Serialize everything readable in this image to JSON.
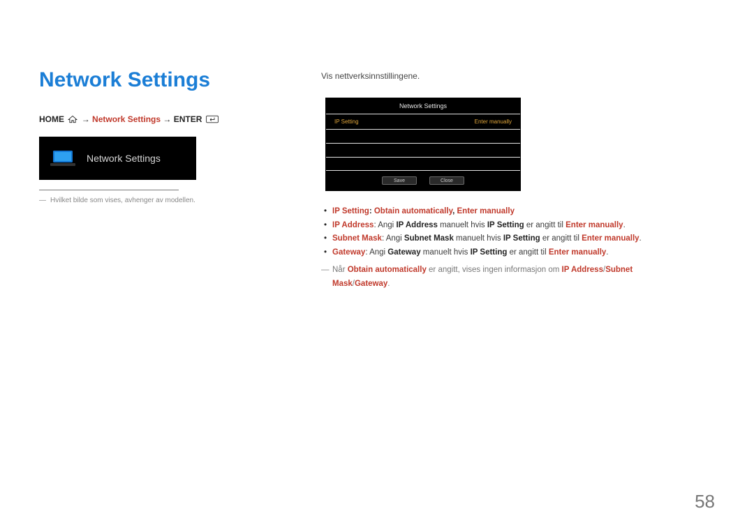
{
  "title": "Network Settings",
  "breadcrumb": {
    "home": "HOME",
    "arrow": "→",
    "mid": "Network Settings",
    "arrow2": "→",
    "enter": "ENTER"
  },
  "tile": {
    "label": "Network Settings"
  },
  "footnote": {
    "dash": "―",
    "text": "Hvilket bilde som vises, avhenger av modellen."
  },
  "intro": "Vis nettverksinnstillingene.",
  "panel": {
    "title": "Network Settings",
    "row_label": "IP Setting",
    "row_value": "Enter manually",
    "save": "Save",
    "close": "Close"
  },
  "bullets": {
    "b1": {
      "label": "IP Setting",
      "sep": ": ",
      "v1": "Obtain automatically",
      "comma": ", ",
      "v2": "Enter manually"
    },
    "b2": {
      "label": "IP Address",
      "sep": ": ",
      "t1": "Angi ",
      "k1": "IP Address",
      "t2": " manuelt hvis ",
      "k2": "IP Setting",
      "t3": " er angitt til ",
      "k3": "Enter manually",
      "dot": "."
    },
    "b3": {
      "label": "Subnet Mask",
      "sep": ": ",
      "t1": "Angi ",
      "k1": "Subnet Mask",
      "t2": " manuelt hvis ",
      "k2": "IP Setting",
      "t3": " er angitt til ",
      "k3": "Enter manually",
      "dot": "."
    },
    "b4": {
      "label": "Gateway",
      "sep": ": ",
      "t1": "Angi ",
      "k1": "Gateway",
      "t2": " manuelt hvis ",
      "k2": "IP Setting",
      "t3": " er angitt til ",
      "k3": "Enter manually",
      "dot": "."
    }
  },
  "note": {
    "dash": "―",
    "t1": "Når ",
    "k1": "Obtain automatically",
    "t2": " er angitt, vises ingen informasjon om ",
    "k2": "IP Address",
    "slash1": "/",
    "k3": "Subnet Mask",
    "slash2": "/",
    "k4": "Gateway",
    "dot": "."
  },
  "page_number": "58"
}
